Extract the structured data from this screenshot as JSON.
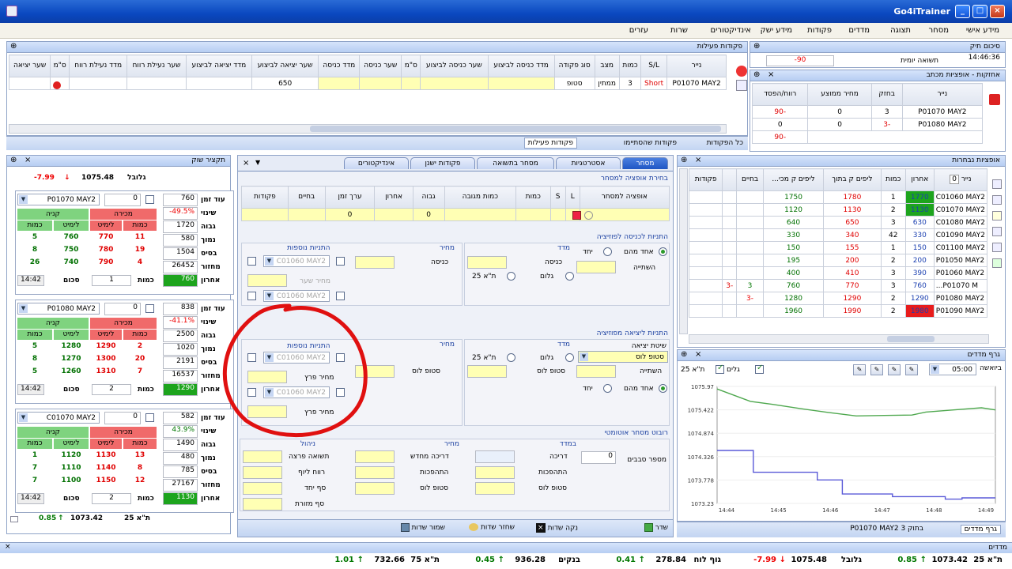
{
  "window": {
    "title": "Go4iTrainer"
  },
  "menu": [
    "מידע אישי",
    "מסחר",
    "תצוגה",
    "מדדים",
    "פקודות",
    "מידע ישק",
    "אינדיקטורים",
    "שרות",
    "עזרים"
  ],
  "active_orders": {
    "title": "פקודות פעילות",
    "headers": [
      "נייר",
      "S/L",
      "כמות",
      "מצב",
      "סוג פקודה",
      "מדד כניסה לביצוע",
      "שער כניסה לביצוע",
      "ס\"מ",
      "שער כניסה",
      "מדד כניסה",
      "שער יציאה לביצוע",
      "מדד יציאה לביצוע",
      "שער נעילת רווח",
      "מדד נעילת רווח",
      "ס\"מ",
      "שער יציאה"
    ],
    "row": [
      "P01070 MAY2",
      "Short",
      "3",
      "ממתין",
      "סטופ",
      "",
      "",
      "",
      "",
      "",
      "650",
      "",
      "",
      "",
      "",
      ""
    ],
    "bottom_tabs": [
      "כל הפקודות",
      "פקודות שהסתיימו",
      "פקודות פעילות"
    ]
  },
  "portfolio": {
    "title": "סיכום תיק",
    "time": "14:46:36",
    "label": "תשואה יומית",
    "value": "-90"
  },
  "positions": {
    "title": "אחזקות - אופציות מכתב",
    "headers": [
      "נייר",
      "בחזק",
      "מחיר ממוצע",
      "רווח/הפסד"
    ],
    "rows": [
      [
        "P01070 MAY2",
        "3",
        "0",
        "-90"
      ],
      [
        "P01080 MAY2",
        "-3",
        "0",
        "0"
      ]
    ],
    "total": "-90"
  },
  "options_board": {
    "title": "אופציות נבחרות",
    "headers": [
      "נייר",
      "כמות",
      "אחרון",
      "כמות",
      "ליפים ק בתוך",
      "ליפים ק מכי...",
      "בחיים",
      "פקודות",
      "אחרון"
    ],
    "filter_value": "0",
    "rows": [
      {
        "name": "C01060 MAY2",
        "last": "1770",
        "qty": "1",
        "buy": "1780",
        "sell": "1750",
        "hold": "",
        "extra": "",
        "color": "g"
      },
      {
        "name": "C01070 MAY2",
        "last": "1130",
        "qty": "2",
        "buy": "1130",
        "sell": "1120",
        "hold": "",
        "extra": "",
        "color": "g"
      },
      {
        "name": "C01080 MAY2",
        "last": "630",
        "qty": "3",
        "buy": "650",
        "sell": "640",
        "hold": "",
        "extra": "",
        "color": ""
      },
      {
        "name": "C01090 MAY2",
        "last": "330",
        "qty": "42",
        "buy": "340",
        "sell": "330",
        "hold": "",
        "extra": "",
        "color": ""
      },
      {
        "name": "C01100 MAY2",
        "last": "150",
        "qty": "1",
        "buy": "155",
        "sell": "150",
        "hold": "",
        "extra": "",
        "color": ""
      },
      {
        "name": "P01050 MAY2",
        "last": "200",
        "qty": "2",
        "buy": "200",
        "sell": "195",
        "hold": "",
        "extra": "",
        "color": ""
      },
      {
        "name": "P01060 MAY2",
        "last": "390",
        "qty": "3",
        "buy": "410",
        "sell": "400",
        "hold": "",
        "extra": "",
        "color": ""
      },
      {
        "name": "P01070 M...",
        "last": "760",
        "qty": "3",
        "buy": "770",
        "sell": "760",
        "hold": "3",
        "extra": "-3",
        "color": ""
      },
      {
        "name": "P01080 MAY2",
        "last": "1290",
        "qty": "2",
        "buy": "1290",
        "sell": "1280",
        "hold": "-3",
        "extra": "",
        "color": ""
      },
      {
        "name": "P01090 MAY2",
        "last": "1980",
        "qty": "2",
        "buy": "1990",
        "sell": "1960",
        "hold": "",
        "extra": "",
        "color": "r"
      }
    ]
  },
  "chart_panel": {
    "title": "גרף מדדים",
    "timeframe": "05:00",
    "period_label": "ביואשה",
    "checks": [
      "גלים",
      "ת\"א 25"
    ],
    "bottom_tabs": [
      "גרף מדדים",
      "P01070 MAY2 בתוק 3"
    ]
  },
  "chart_data": {
    "type": "line",
    "x": [
      "14:44",
      "14:45",
      "14:46",
      "14:47",
      "14:48",
      "14:49"
    ],
    "yticks": [
      "1075.97",
      "1075.422",
      "1074.874",
      "1074.326",
      "1073.778",
      "1073.23"
    ],
    "ylim": [
      1073.23,
      1075.97
    ],
    "series": [
      {
        "name": "ת\"א 25",
        "color": "#4fa84f",
        "points": [
          [
            0,
            1075.91
          ],
          [
            0.12,
            1075.62
          ],
          [
            0.2,
            1075.55
          ],
          [
            0.3,
            1075.45
          ],
          [
            0.4,
            1075.36
          ],
          [
            0.5,
            1075.28
          ],
          [
            0.6,
            1075.29
          ],
          [
            0.7,
            1075.3
          ],
          [
            0.75,
            1075.37
          ],
          [
            0.85,
            1075.42
          ],
          [
            0.95,
            1075.47
          ],
          [
            1,
            1075.42
          ]
        ]
      },
      {
        "name": "גלים",
        "color": "#5a5ad8",
        "points": [
          [
            0,
            1074.47
          ],
          [
            0.13,
            1074.47
          ],
          [
            0.13,
            1073.96
          ],
          [
            0.36,
            1073.96
          ],
          [
            0.36,
            1073.78
          ],
          [
            0.45,
            1073.78
          ],
          [
            0.45,
            1073.45
          ],
          [
            0.63,
            1073.45
          ],
          [
            0.63,
            1073.39
          ],
          [
            0.82,
            1073.39
          ],
          [
            0.82,
            1073.33
          ],
          [
            0.88,
            1073.33
          ],
          [
            0.88,
            1073.36
          ],
          [
            1,
            1073.36
          ]
        ]
      }
    ]
  },
  "market_watch": {
    "title": "תקציר שוק",
    "index_label": "גלובל",
    "index_value": "1075.48",
    "index_change": "-7.99",
    "bottom_label": "ת\"א 25",
    "bottom_value": "1073.42",
    "bottom_change": "0.85",
    "quotes": [
      {
        "name": "P01080 MAY2",
        "qty": "0",
        "last": "838",
        "change": "-41.1%",
        "high": "2500",
        "low": "1020",
        "open": "2191",
        "volume": "16537",
        "close": "1290",
        "bid_qty": [
          "2",
          "20",
          "7"
        ],
        "bid": [
          "1290",
          "1300",
          "1310"
        ],
        "ask": [
          "1280",
          "1270",
          "1260"
        ],
        "ask_qty": [
          "5",
          "8",
          "5"
        ],
        "time": "14:42",
        "mq": "2"
      },
      {
        "name": "C01070 MAY2",
        "qty": "0",
        "last": "582",
        "change": "43.9%",
        "high": "1490",
        "low": "480",
        "open": "785",
        "volume": "27167",
        "close": "1130",
        "bid_qty": [
          "13",
          "8",
          "12"
        ],
        "bid": [
          "1130",
          "1140",
          "1150"
        ],
        "ask": [
          "1120",
          "1110",
          "1100"
        ],
        "ask_qty": [
          "1",
          "7",
          "7"
        ],
        "time": "14:42",
        "mq": "2"
      }
    ],
    "first": {
      "name": "P01070 MAY2",
      "qty": "0",
      "last": "760",
      "change": "-49.5%",
      "high": "1720",
      "low": "580",
      "open": "1504",
      "volume": "26452",
      "close": "760",
      "bid_qty": [
        "11",
        "19",
        "4"
      ],
      "bid": [
        "770",
        "780",
        "790"
      ],
      "ask": [
        "760",
        "750",
        "740"
      ],
      "ask_qty": [
        "5",
        "8",
        "26"
      ],
      "time": "14:42",
      "mq": "1"
    },
    "row_labels": [
      "עוד זמן",
      "שינוי",
      "גבוה",
      "נמוך",
      "בסיס",
      "מחזור",
      "אחרון"
    ],
    "side_buy": "קניה",
    "side_sell": "מכירה",
    "col_qty": "כמות",
    "col_limit": "לימיט",
    "qty_label": "כמות",
    "sum_label": "סכום"
  },
  "trade_form": {
    "tabs": [
      "מסחר",
      "אסטרטגיות",
      "מסחר בתשואה",
      "פקודות ישנן",
      "אינדיקטורים"
    ],
    "sub_title": "בחירת אופציה למסחר",
    "grid_headers": [
      "אופציה למסחר",
      "L",
      "S",
      "כמות",
      "כמות מגובה",
      "גבוה",
      "אחרון",
      "ערך זמן",
      "בחיים",
      "פקודות"
    ],
    "grid_row": [
      "",
      "",
      "",
      "",
      "",
      "0",
      "",
      "0",
      "",
      ""
    ],
    "entry_title": "התניות לכניסה לפוזיציה",
    "extra_title": "התניות נוספות",
    "exit_title": "התניות ליציאה מפוזיציה",
    "extra_title2": "התניות נוספות",
    "index_label": "מדד",
    "price_label": "מחיר",
    "radio_labels": [
      "אחד מהם",
      "יחד",
      "גלום",
      "ת\"א 25"
    ],
    "entry_label": "כניסה",
    "change_label": "השתייה",
    "exit_type_label": "שיטת יציאה",
    "exit_type_value": "סטופ לוס",
    "stop_loss": "סטופ לוס",
    "profit_price": "מחיר פרץ",
    "option_value": "C01060 MAY2",
    "min_price": "מחיר שער",
    "auto_title": "רובוט מסחר אוטומטי",
    "auto_cols": [
      "במדד",
      "מחיר",
      "ניהול"
    ],
    "auto_labels": [
      "דריכה",
      "התהפכות",
      "סטופ לוס"
    ],
    "auto_labels2": [
      "דריכה מחדש",
      "התהפכות",
      "סטופ לוס"
    ],
    "auto_labels3": [
      "תשואה פרצה",
      "רווח ליוף",
      "סף יחד",
      "סף מזורת"
    ],
    "round_label": "מספר סבבים",
    "round_value": "0",
    "buttons": [
      "שדר",
      "נקה שדות",
      "שחזר שדות",
      "שמור שדות"
    ]
  },
  "status": {
    "title": "מדדים",
    "items": [
      "ת\"א 25",
      "1073.42",
      "0.85",
      "גלובל",
      "1075.48",
      "-7.99",
      "גוף לוח",
      "278.84",
      "0.41",
      "בנקים",
      "936.28",
      "0.45",
      "ת\"א 75",
      "732.66",
      "1.01"
    ]
  }
}
